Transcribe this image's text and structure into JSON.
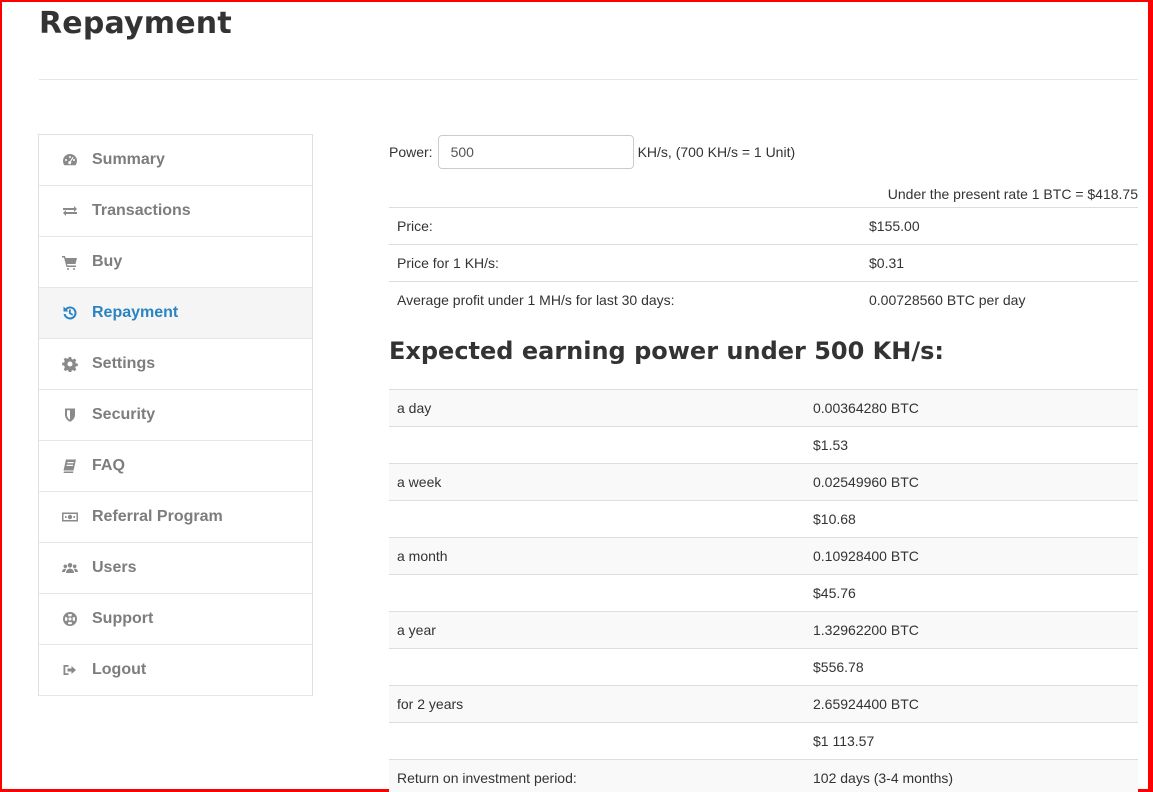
{
  "page": {
    "title": "Repayment"
  },
  "sidebar": {
    "items": [
      {
        "label": "Summary",
        "icon": "dashboard-icon"
      },
      {
        "label": "Transactions",
        "icon": "exchange-icon"
      },
      {
        "label": "Buy",
        "icon": "cart-icon"
      },
      {
        "label": "Repayment",
        "icon": "history-icon",
        "active": true
      },
      {
        "label": "Settings",
        "icon": "gear-icon"
      },
      {
        "label": "Security",
        "icon": "shield-icon"
      },
      {
        "label": "FAQ",
        "icon": "book-icon"
      },
      {
        "label": "Referral Program",
        "icon": "money-icon"
      },
      {
        "label": "Users",
        "icon": "users-icon"
      },
      {
        "label": "Support",
        "icon": "lifebuoy-icon"
      },
      {
        "label": "Logout",
        "icon": "sign-out-icon"
      }
    ]
  },
  "power": {
    "label": "Power:",
    "value": "500",
    "unit": "KH/s, (700 KH/s = 1 Unit)"
  },
  "rate_note": "Under the present rate 1 BTC = $418.75",
  "info_rows": [
    {
      "label": "Price:",
      "value": "$155.00"
    },
    {
      "label": "Price for 1 KH/s:",
      "value": "$0.31"
    },
    {
      "label": "Average profit under 1 MH/s for last 30 days:",
      "value": "0.00728560 BTC per day"
    }
  ],
  "earnings": {
    "title": "Expected earning power under 500 KH/s:",
    "rows": [
      {
        "period": "a day",
        "value": "0.00364280 BTC"
      },
      {
        "period": "",
        "value": "$1.53"
      },
      {
        "period": "a week",
        "value": "0.02549960 BTC"
      },
      {
        "period": "",
        "value": "$10.68"
      },
      {
        "period": "a month",
        "value": "0.10928400 BTC"
      },
      {
        "period": "",
        "value": "$45.76"
      },
      {
        "period": "a year",
        "value": "1.32962200 BTC"
      },
      {
        "period": "",
        "value": "$556.78"
      },
      {
        "period": "for 2 years",
        "value": "2.65924400 BTC"
      },
      {
        "period": "",
        "value": "$1 113.57"
      },
      {
        "period": "Return on investment period:",
        "value": "102 days (3-4 months)"
      }
    ]
  },
  "colors": {
    "accent": "#2a84c4",
    "frame": "#ff0000",
    "muted": "#7d7d7d"
  }
}
